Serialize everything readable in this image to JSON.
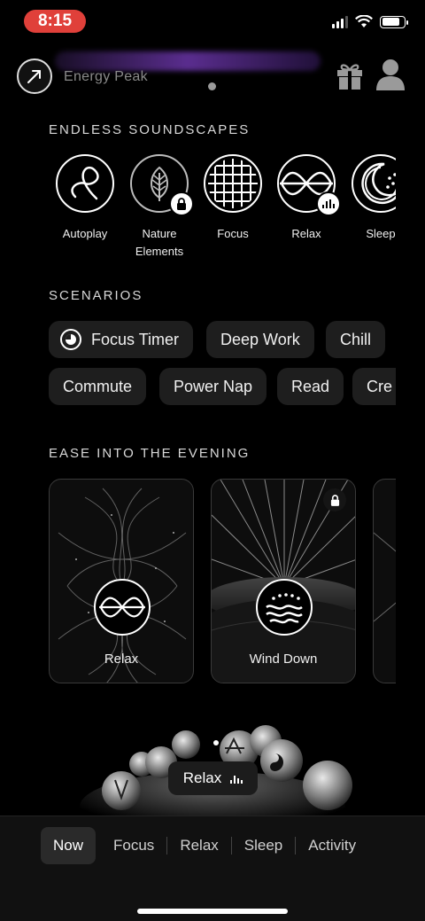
{
  "status_bar": {
    "time": "8:15",
    "time_pill_color": "#e0403a",
    "battery_level": 0.8
  },
  "header": {
    "energy_label": "Energy Peak",
    "icons": [
      "energy-arrow-icon",
      "gift-icon",
      "profile-icon"
    ]
  },
  "soundscapes": {
    "title": "ENDLESS SOUNDSCAPES",
    "items": [
      {
        "label": "Autoplay",
        "icon": "autoplay-icon"
      },
      {
        "label": "Nature",
        "label2": "Elements",
        "icon": "leaf-icon",
        "locked": true
      },
      {
        "label": "Focus",
        "icon": "grid-sphere-icon"
      },
      {
        "label": "Relax",
        "icon": "wave-icon",
        "playing": true
      },
      {
        "label": "Sleep",
        "icon": "moon-icon"
      }
    ]
  },
  "scenarios": {
    "title": "SCENARIOS",
    "row1": [
      "Focus Timer",
      "Deep Work",
      "Chill"
    ],
    "row2": [
      "Commute",
      "Power Nap",
      "Read",
      "Cre"
    ]
  },
  "evening": {
    "title": "EASE INTO THE EVENING",
    "cards": [
      {
        "label": "Relax",
        "icon": "wave-icon",
        "locked": false
      },
      {
        "label": "Wind Down",
        "icon": "sunset-waves-icon",
        "locked": true
      }
    ]
  },
  "mini_player": {
    "label": "Relax"
  },
  "tabs": {
    "items": [
      "Now",
      "Focus",
      "Relax",
      "Sleep",
      "Activity"
    ],
    "active": "Now"
  }
}
